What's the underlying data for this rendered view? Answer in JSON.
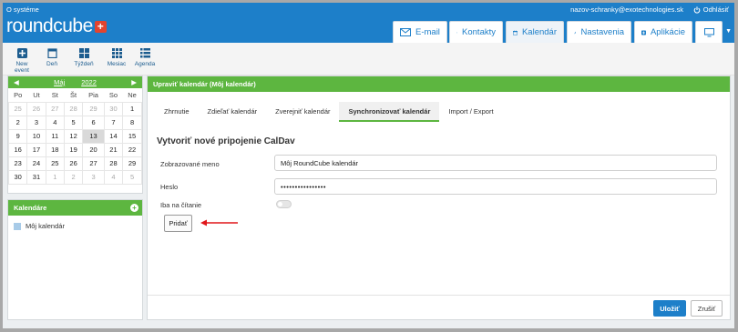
{
  "app": {
    "about_link": "O systéme",
    "logo_text": "roundcube",
    "user_email": "nazov-schranky@exotechnologies.sk",
    "logout_label": "Odhlásiť"
  },
  "nav_tabs": [
    {
      "label": "E-mail",
      "icon": "envelope-icon"
    },
    {
      "label": "Kontakty",
      "icon": "person-icon"
    },
    {
      "label": "Kalendár",
      "icon": "calendar-icon"
    },
    {
      "label": "Nastavenia",
      "icon": "wrench-icon"
    },
    {
      "label": "Aplikácie",
      "icon": "plus-square-icon"
    },
    {
      "label": "",
      "icon": "monitor-icon"
    }
  ],
  "toolbar": {
    "items": [
      {
        "label": "New event",
        "icon": "plus-icon"
      },
      {
        "label": "Deň",
        "icon": "day-icon"
      },
      {
        "label": "Týždeň",
        "icon": "week-icon"
      },
      {
        "label": "Mesiac",
        "icon": "month-icon"
      },
      {
        "label": "Agenda",
        "icon": "agenda-icon"
      }
    ]
  },
  "mini_calendar": {
    "month": "Máj",
    "year": "2022",
    "weekdays": [
      "Po",
      "Ut",
      "St",
      "Št",
      "Pia",
      "So",
      "Ne"
    ],
    "weeks": [
      [
        "25",
        "26",
        "27",
        "28",
        "29",
        "30",
        "1"
      ],
      [
        "2",
        "3",
        "4",
        "5",
        "6",
        "7",
        "8"
      ],
      [
        "9",
        "10",
        "11",
        "12",
        "13",
        "14",
        "15"
      ],
      [
        "16",
        "17",
        "18",
        "19",
        "20",
        "21",
        "22"
      ],
      [
        "23",
        "24",
        "25",
        "26",
        "27",
        "28",
        "29"
      ],
      [
        "30",
        "31",
        "1",
        "2",
        "3",
        "4",
        "5"
      ]
    ],
    "today": "13"
  },
  "calendars": {
    "title": "Kalendáre",
    "items": [
      {
        "name": "Môj kalendár",
        "color": "#a8cbe8"
      }
    ]
  },
  "main": {
    "title": "Upraviť kalendár (Môj kalendár)",
    "tabs": [
      "Zhrnutie",
      "Zdieľať kalendár",
      "Zverejniť kalendár",
      "Synchronizovať kalendár",
      "Import / Export"
    ],
    "active_tab": "Synchronizovať kalendár",
    "section_title": "Vytvoriť nové pripojenie CalDav",
    "fields": {
      "display_name_label": "Zobrazované meno",
      "display_name_value": "Môj RoundCube kalendár",
      "password_label": "Heslo",
      "password_value": "••••••••••••••••",
      "readonly_label": "Iba na čítanie"
    },
    "add_button": "Pridať",
    "save_button": "Uložiť",
    "cancel_button": "Zrušiť"
  },
  "colors": {
    "brand_blue": "#1d7fc9",
    "header_green": "#5db640",
    "logo_red": "#e2442f",
    "annotation_arrow": "#e0161a"
  }
}
